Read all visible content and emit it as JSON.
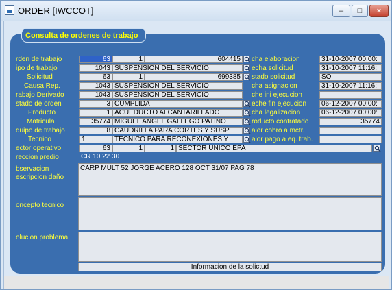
{
  "window": {
    "title": "ORDER [IWCCOT]"
  },
  "header": {
    "title": "Consulta de ordenes de trabajo"
  },
  "labels": {
    "orden_trabajo": "rden de trabajo",
    "tipo_trabajo": "ipo de trabajo",
    "solicitud": "Solicitud",
    "causa_rep": "Causa Rep.",
    "trabajo_derivado": "rabajo Derivado",
    "estado_orden": "stado de orden",
    "producto": "Producto",
    "matricula": "Matricula",
    "equipo_trabajo": "quipo de trabajo",
    "tecnico": "Tecnico",
    "sector_operativo": "ector operativo",
    "direccion_predio": "reccion predio",
    "observacion": "bservacion",
    "descripcion_dano": "escripcion daño",
    "concepto_tecnico": "oncepto tecnico",
    "solucion_problema": "olucion problema",
    "fecha_elaboracion": "cha elaboracion",
    "fecha_solicitud": "echa solicitud",
    "estado_solicitud": "stado solicitud",
    "fecha_asignacion": "cha asignacion",
    "fecha_ini_ejecucion": "che ini ejecucion",
    "fecha_fin_ejecucion": "eche fin ejecucion",
    "fecha_legalizacion": "cha legalizacion",
    "producto_contratado": "roducto contratado",
    "valor_cobro": "alor cobro a mctr.",
    "valor_pago": "alor pago a eq. trab."
  },
  "values": {
    "orden_1": "63",
    "orden_2": "1",
    "orden_3": "604415",
    "tipo_code": "1043",
    "tipo_desc": "SUSPENSION DEL SERVICIO",
    "solicitud_1": "63",
    "solicitud_2": "1",
    "solicitud_3": "699385",
    "causa_code": "1043",
    "causa_desc": "SUSPENSION DEL SERVICIO",
    "derivado_code": "1043",
    "derivado_desc": "SUSPENSION DEL SERVICIO",
    "estado_code": "3",
    "estado_desc": "CUMPLIDA",
    "producto_code": "1",
    "producto_desc": "ACUEDUCTO ALCANTARILLADO",
    "matricula_code": "35774",
    "matricula_desc": "MIGUEL ANGEL GALLEGO PATIÑO",
    "equipo_code": "8",
    "equipo_desc": "CAUDRILLA PARA CORTES Y SUSP",
    "tecnico_code": "1",
    "tecnico_desc": "TECNICO PARA RECONEXIONES Y",
    "sector_1": "63",
    "sector_2": "1",
    "sector_3": "1",
    "sector_desc": "SECTOR UNICO EPA",
    "direccion": "CR 10 22 30",
    "observacion": "CARP MULT 52 JORGE ACERO 128 OCT 31/07 PAG 78",
    "fecha_elaboracion": "31-10-2007 00:00:",
    "fecha_solicitud": "31-10-2007 11:16:",
    "estado_solicitud": "SO",
    "fecha_asignacion": "31-10-2007 11:16:",
    "fecha_fin_ejecucion": "06-12-2007 00:00:",
    "fecha_legalizacion": "06-12-2007 00:00:",
    "producto_contratado": "35774"
  },
  "footer": {
    "info_solicitud": "Informacion de la solictud"
  },
  "colors": {
    "panel": "#3a6eaf",
    "label": "#ffff3a",
    "field": "#e4e8ee",
    "selected": "#2f62c8"
  }
}
